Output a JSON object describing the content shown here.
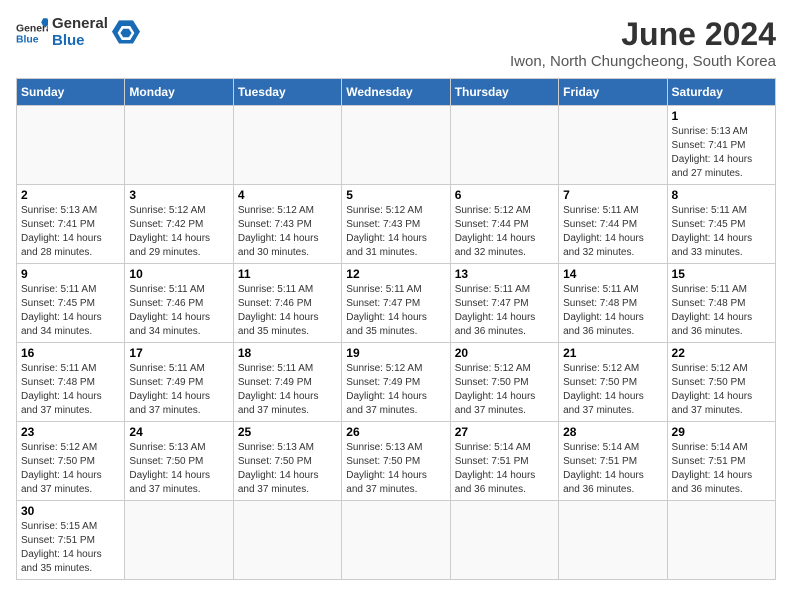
{
  "header": {
    "logo_text_general": "General",
    "logo_text_blue": "Blue",
    "month_title": "June 2024",
    "subtitle": "Iwon, North Chungcheong, South Korea"
  },
  "weekdays": [
    "Sunday",
    "Monday",
    "Tuesday",
    "Wednesday",
    "Thursday",
    "Friday",
    "Saturday"
  ],
  "weeks": [
    [
      {
        "day": "",
        "info": ""
      },
      {
        "day": "",
        "info": ""
      },
      {
        "day": "",
        "info": ""
      },
      {
        "day": "",
        "info": ""
      },
      {
        "day": "",
        "info": ""
      },
      {
        "day": "",
        "info": ""
      },
      {
        "day": "1",
        "info": "Sunrise: 5:13 AM\nSunset: 7:41 PM\nDaylight: 14 hours\nand 27 minutes."
      }
    ],
    [
      {
        "day": "2",
        "info": "Sunrise: 5:13 AM\nSunset: 7:41 PM\nDaylight: 14 hours\nand 28 minutes."
      },
      {
        "day": "3",
        "info": "Sunrise: 5:12 AM\nSunset: 7:42 PM\nDaylight: 14 hours\nand 29 minutes."
      },
      {
        "day": "4",
        "info": "Sunrise: 5:12 AM\nSunset: 7:43 PM\nDaylight: 14 hours\nand 30 minutes."
      },
      {
        "day": "5",
        "info": "Sunrise: 5:12 AM\nSunset: 7:43 PM\nDaylight: 14 hours\nand 31 minutes."
      },
      {
        "day": "6",
        "info": "Sunrise: 5:12 AM\nSunset: 7:44 PM\nDaylight: 14 hours\nand 32 minutes."
      },
      {
        "day": "7",
        "info": "Sunrise: 5:11 AM\nSunset: 7:44 PM\nDaylight: 14 hours\nand 32 minutes."
      },
      {
        "day": "8",
        "info": "Sunrise: 5:11 AM\nSunset: 7:45 PM\nDaylight: 14 hours\nand 33 minutes."
      }
    ],
    [
      {
        "day": "9",
        "info": "Sunrise: 5:11 AM\nSunset: 7:45 PM\nDaylight: 14 hours\nand 34 minutes."
      },
      {
        "day": "10",
        "info": "Sunrise: 5:11 AM\nSunset: 7:46 PM\nDaylight: 14 hours\nand 34 minutes."
      },
      {
        "day": "11",
        "info": "Sunrise: 5:11 AM\nSunset: 7:46 PM\nDaylight: 14 hours\nand 35 minutes."
      },
      {
        "day": "12",
        "info": "Sunrise: 5:11 AM\nSunset: 7:47 PM\nDaylight: 14 hours\nand 35 minutes."
      },
      {
        "day": "13",
        "info": "Sunrise: 5:11 AM\nSunset: 7:47 PM\nDaylight: 14 hours\nand 36 minutes."
      },
      {
        "day": "14",
        "info": "Sunrise: 5:11 AM\nSunset: 7:48 PM\nDaylight: 14 hours\nand 36 minutes."
      },
      {
        "day": "15",
        "info": "Sunrise: 5:11 AM\nSunset: 7:48 PM\nDaylight: 14 hours\nand 36 minutes."
      }
    ],
    [
      {
        "day": "16",
        "info": "Sunrise: 5:11 AM\nSunset: 7:48 PM\nDaylight: 14 hours\nand 37 minutes."
      },
      {
        "day": "17",
        "info": "Sunrise: 5:11 AM\nSunset: 7:49 PM\nDaylight: 14 hours\nand 37 minutes."
      },
      {
        "day": "18",
        "info": "Sunrise: 5:11 AM\nSunset: 7:49 PM\nDaylight: 14 hours\nand 37 minutes."
      },
      {
        "day": "19",
        "info": "Sunrise: 5:12 AM\nSunset: 7:49 PM\nDaylight: 14 hours\nand 37 minutes."
      },
      {
        "day": "20",
        "info": "Sunrise: 5:12 AM\nSunset: 7:50 PM\nDaylight: 14 hours\nand 37 minutes."
      },
      {
        "day": "21",
        "info": "Sunrise: 5:12 AM\nSunset: 7:50 PM\nDaylight: 14 hours\nand 37 minutes."
      },
      {
        "day": "22",
        "info": "Sunrise: 5:12 AM\nSunset: 7:50 PM\nDaylight: 14 hours\nand 37 minutes."
      }
    ],
    [
      {
        "day": "23",
        "info": "Sunrise: 5:12 AM\nSunset: 7:50 PM\nDaylight: 14 hours\nand 37 minutes."
      },
      {
        "day": "24",
        "info": "Sunrise: 5:13 AM\nSunset: 7:50 PM\nDaylight: 14 hours\nand 37 minutes."
      },
      {
        "day": "25",
        "info": "Sunrise: 5:13 AM\nSunset: 7:50 PM\nDaylight: 14 hours\nand 37 minutes."
      },
      {
        "day": "26",
        "info": "Sunrise: 5:13 AM\nSunset: 7:50 PM\nDaylight: 14 hours\nand 37 minutes."
      },
      {
        "day": "27",
        "info": "Sunrise: 5:14 AM\nSunset: 7:51 PM\nDaylight: 14 hours\nand 36 minutes."
      },
      {
        "day": "28",
        "info": "Sunrise: 5:14 AM\nSunset: 7:51 PM\nDaylight: 14 hours\nand 36 minutes."
      },
      {
        "day": "29",
        "info": "Sunrise: 5:14 AM\nSunset: 7:51 PM\nDaylight: 14 hours\nand 36 minutes."
      }
    ],
    [
      {
        "day": "30",
        "info": "Sunrise: 5:15 AM\nSunset: 7:51 PM\nDaylight: 14 hours\nand 35 minutes."
      },
      {
        "day": "",
        "info": ""
      },
      {
        "day": "",
        "info": ""
      },
      {
        "day": "",
        "info": ""
      },
      {
        "day": "",
        "info": ""
      },
      {
        "day": "",
        "info": ""
      },
      {
        "day": "",
        "info": ""
      }
    ]
  ]
}
